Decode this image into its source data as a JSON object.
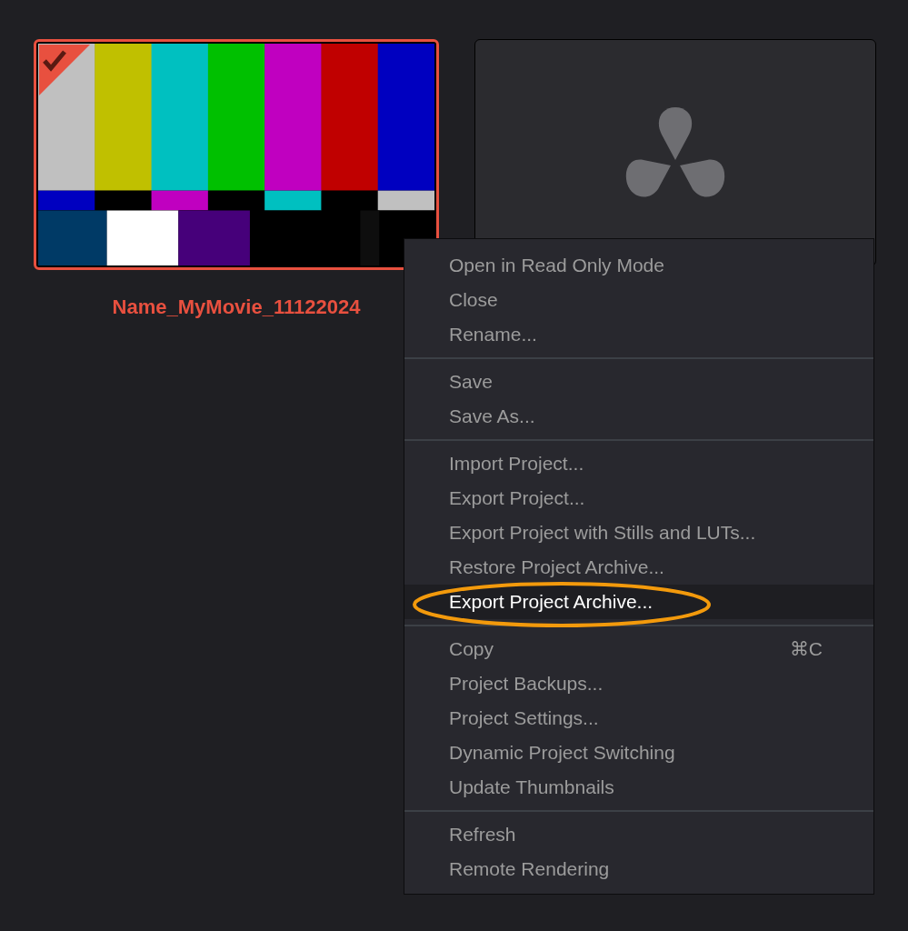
{
  "projects": [
    {
      "kind": "color-bars",
      "name": "Name_MyMovie_11122024",
      "selected": true
    },
    {
      "kind": "logo",
      "selected": false
    }
  ],
  "context_menu": {
    "groups": [
      {
        "items": [
          {
            "label": "Open in Read Only Mode",
            "selected": false
          },
          {
            "label": "Close",
            "selected": false
          },
          {
            "label": "Rename...",
            "selected": false
          }
        ]
      },
      {
        "items": [
          {
            "label": "Save",
            "selected": false
          },
          {
            "label": "Save As...",
            "selected": false
          }
        ]
      },
      {
        "items": [
          {
            "label": "Import Project...",
            "selected": false
          },
          {
            "label": "Export Project...",
            "selected": false
          },
          {
            "label": "Export Project with Stills and LUTs...",
            "selected": false
          },
          {
            "label": "Restore Project Archive...",
            "selected": false
          },
          {
            "label": "Export Project Archive...",
            "selected": true,
            "circled": true
          }
        ]
      },
      {
        "items": [
          {
            "label": "Copy",
            "selected": false,
            "shortcut": "⌘C"
          },
          {
            "label": "Project Backups...",
            "selected": false
          },
          {
            "label": "Project Settings...",
            "selected": false
          },
          {
            "label": "Dynamic Project Switching",
            "selected": false
          },
          {
            "label": "Update Thumbnails",
            "selected": false
          }
        ]
      },
      {
        "items": [
          {
            "label": "Refresh",
            "selected": false
          },
          {
            "label": "Remote Rendering",
            "selected": false
          }
        ]
      }
    ]
  }
}
